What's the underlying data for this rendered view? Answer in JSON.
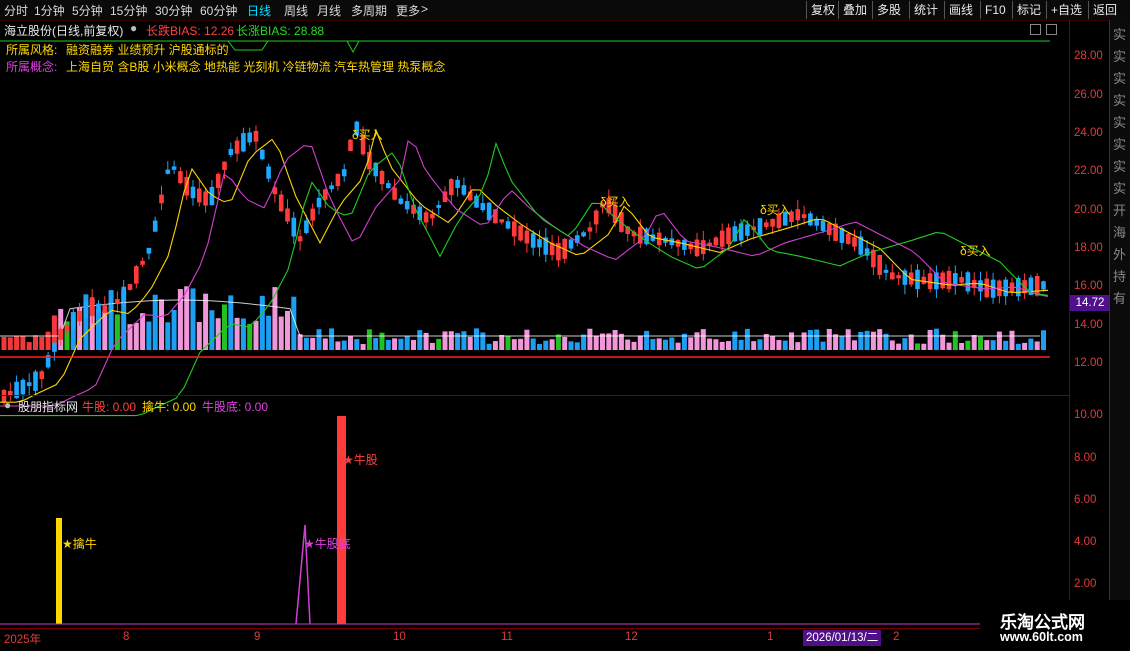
{
  "period_tabs": [
    "分时",
    "1分钟",
    "5分钟",
    "15分钟",
    "30分钟",
    "60分钟",
    "日线",
    "周线",
    "月线",
    "多周期",
    "更多"
  ],
  "active_tab": "日线",
  "more_arrow": ">",
  "toolbar_right": [
    "复权",
    "叠加",
    "多股",
    "统计",
    "画线",
    "F10",
    "标记",
    "+自选",
    "返回"
  ],
  "stock_title": "海立股份(日线,前复权)",
  "bias_short_label": "长跌BIAS: 12.26",
  "bias_long_label": "长涨BIAS: 28.88",
  "style_label": "所属风格:",
  "style_value": "融资融券 业绩预升 沪股通标的",
  "concept_label": "所属概念:",
  "concept_value": "上海自贸 含B股 小米概念 地热能 光刻机 冷链物流 汽车热管理 热泵概念",
  "price_axis": [
    "28.00",
    "26.00",
    "24.00",
    "22.00",
    "20.00",
    "18.00",
    "16.00",
    "14.00",
    "12.00"
  ],
  "current_price": "14.72",
  "buy_label": "δ买入",
  "indicator_name": "股朋指标网",
  "ind_cattle": "牛股: 0.00",
  "ind_grab": "擒牛: 0.00",
  "ind_bottom": "牛股底: 0.00",
  "ind_axis": [
    "10.00",
    "8.00",
    "6.00",
    "4.00",
    "2.00"
  ],
  "ann_grab": "★擒牛",
  "ann_bottom": "★牛股底",
  "ann_cattle": "★牛股",
  "time_axis": [
    "2025年",
    "8",
    "9",
    "10",
    "11",
    "12",
    "1",
    "2"
  ],
  "cursor_date": "2026/01/13/二",
  "watermark_title": "乐淘公式网",
  "watermark_url": "www.60lt.com",
  "right_strip_chars": "实实实实实实实实开海外持有",
  "colors": {
    "up": "#ff3b3b",
    "down": "#1ea8ff",
    "volume_pink": "#ff9ee6",
    "ma_yellow": "#ffd700",
    "ma_purple": "#d040d0",
    "ma_green": "#22cc22",
    "accent": "#e03c3c"
  }
}
